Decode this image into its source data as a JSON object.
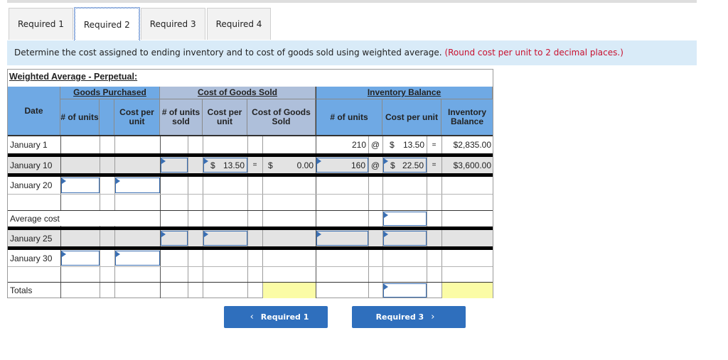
{
  "tabs": [
    {
      "label": "Required 1",
      "active": false
    },
    {
      "label": "Required 2",
      "active": true
    },
    {
      "label": "Required 3",
      "active": false
    },
    {
      "label": "Required 4",
      "active": false
    }
  ],
  "instruction": {
    "text": "Determine the cost assigned to ending inventory and to cost of goods sold using weighted average.",
    "note": "(Round cost per unit to 2 decimal places.)"
  },
  "sheet": {
    "title": "Weighted Average - Perpetual:",
    "groups": {
      "goods_purchased": "Goods Purchased",
      "cost_of_goods_sold": "Cost of Goods Sold",
      "inventory_balance": "Inventory Balance"
    },
    "columns": {
      "date": "Date",
      "gp_units": "# of units",
      "gp_cost": "Cost per unit",
      "cogs_units": "# of units sold",
      "cogs_cpu": "Cost per unit",
      "cogs_total": "Cost of Goods Sold",
      "ib_units": "# of units",
      "ib_cpu": "Cost per unit",
      "ib_balance": "Inventory Balance"
    },
    "rows": {
      "jan1": {
        "date": "January 1",
        "ib_units": "210",
        "at": "@",
        "ib_cpu_dollar": "$",
        "ib_cpu": "13.50",
        "eq": "=",
        "ib_balance": "$2,835.00"
      },
      "jan10": {
        "date": "January 10",
        "cogs_units": "",
        "cogs_cpu_dollar": "$",
        "cogs_cpu": "13.50",
        "eq1": "=",
        "cogs_dollar": "$",
        "cogs_total": "0.00",
        "ib_units": "160",
        "at": "@",
        "ib_cpu_dollar": "$",
        "ib_cpu": "22.50",
        "eq2": "=",
        "ib_balance": "$3,600.00"
      },
      "jan20": {
        "date": "January 20",
        "gp_units": "",
        "gp_cost": ""
      },
      "avg": {
        "label": "Average cost",
        "ib_cpu": ""
      },
      "jan25": {
        "date": "January 25",
        "cogs_units": "",
        "cogs_cpu": "",
        "ib_units": "",
        "ib_cpu": ""
      },
      "jan30": {
        "date": "January 30",
        "gp_units": "",
        "gp_cost": ""
      },
      "totals": {
        "label": "Totals",
        "ib_cpu": ""
      }
    }
  },
  "nav": {
    "prev_label": "Required 1",
    "next_label": "Required 3",
    "prev_icon": "‹",
    "next_icon": "›"
  }
}
